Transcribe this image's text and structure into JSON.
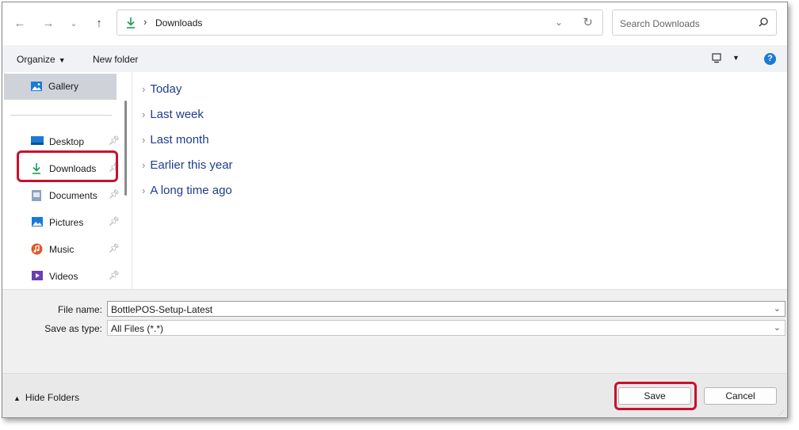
{
  "nav": {
    "back_icon": "arrow-left-icon",
    "forward_icon": "arrow-right-icon",
    "recent_icon": "chevron-down-icon",
    "up_icon": "arrow-up-icon"
  },
  "address": {
    "crumb": "Downloads",
    "separator": "›"
  },
  "search": {
    "placeholder": "Search Downloads"
  },
  "toolbar": {
    "organize_label": "Organize",
    "new_folder_label": "New folder",
    "help_label": "?"
  },
  "sidebar": {
    "gallery": "Gallery",
    "items": [
      {
        "label": "Desktop",
        "icon": "desktop-icon"
      },
      {
        "label": "Downloads",
        "icon": "downloads-icon"
      },
      {
        "label": "Documents",
        "icon": "documents-icon"
      },
      {
        "label": "Pictures",
        "icon": "pictures-icon"
      },
      {
        "label": "Music",
        "icon": "music-icon"
      },
      {
        "label": "Videos",
        "icon": "videos-icon"
      }
    ]
  },
  "groups": [
    "Today",
    "Last week",
    "Last month",
    "Earlier this year",
    "A long time ago"
  ],
  "form": {
    "file_name_label": "File name:",
    "file_name_value": "BottlePOS-Setup-Latest",
    "save_type_label": "Save as type:",
    "save_type_value": "All Files (*.*)"
  },
  "footer": {
    "hide_folders_label": "Hide Folders",
    "save_label": "Save",
    "cancel_label": "Cancel"
  },
  "colors": {
    "accent": "#1a7ad6",
    "highlight": "#c8102e",
    "group_text": "#1f3d8f",
    "download_green": "#1f9c55"
  }
}
